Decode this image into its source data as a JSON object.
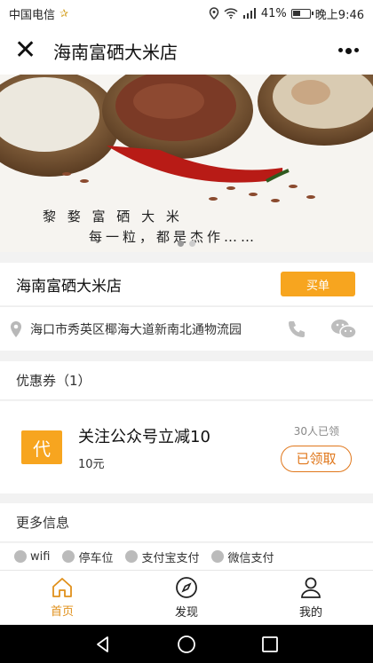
{
  "status": {
    "carrier": "中国电信",
    "battery": "41%",
    "time": "晚上9:46"
  },
  "header": {
    "title": "海南富硒大米店"
  },
  "banner": {
    "slogan_line1": "黎 婺 富 硒 大 米",
    "slogan_line2": "每一粒，都是杰作……"
  },
  "shop": {
    "name": "海南富硒大米店",
    "pay_label": "买单"
  },
  "address": {
    "text": "海口市秀英区椰海大道新南北通物流园"
  },
  "coupons": {
    "heading": "优惠券（1）",
    "items": [
      {
        "badge": "代",
        "title": "关注公众号立减10",
        "value": "10元",
        "taken": "30人已领",
        "button": "已领取"
      }
    ]
  },
  "more_info": {
    "heading": "更多信息",
    "facilities": [
      "wifi",
      "停车位",
      "支付宝支付",
      "微信支付"
    ]
  },
  "tabbar": {
    "items": [
      {
        "label": "首页",
        "icon": "home-icon"
      },
      {
        "label": "发现",
        "icon": "compass-icon"
      },
      {
        "label": "我的",
        "icon": "user-icon"
      }
    ],
    "active_color": "#e0901b"
  },
  "colors": {
    "accent": "#f7a51f",
    "claimed": "#e0771b"
  }
}
